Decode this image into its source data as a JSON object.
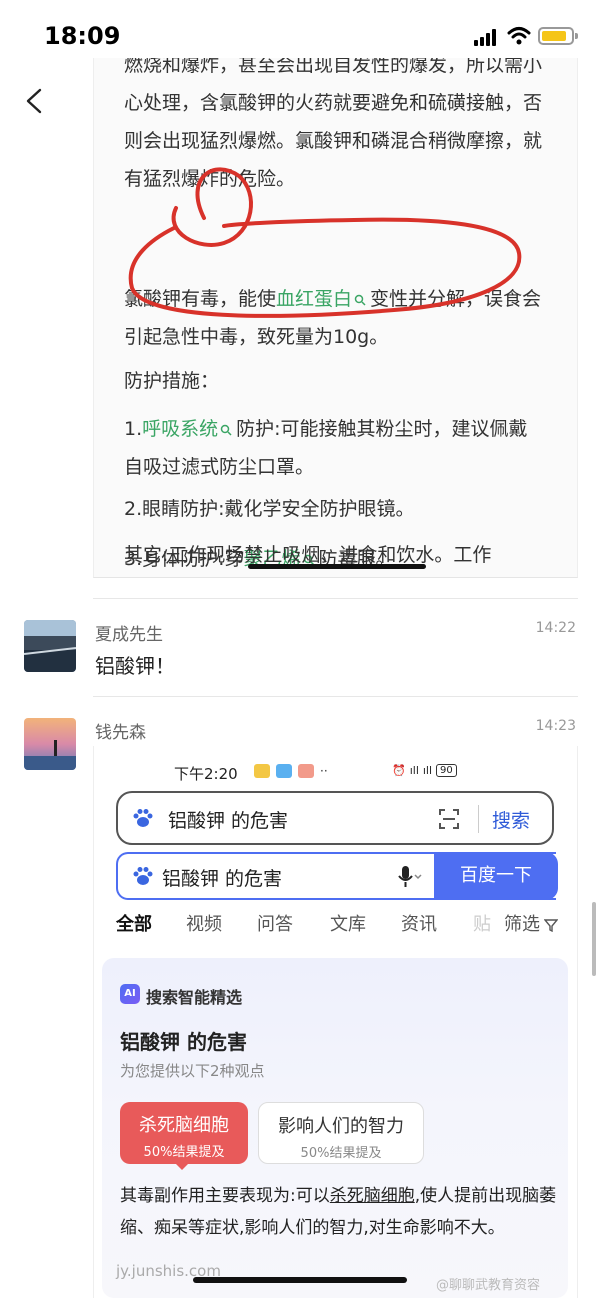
{
  "status_bar": {
    "time": "18:09"
  },
  "article": {
    "para1": "燃烧和爆炸，甚至会出现自发性的爆发，所以需小心处理，含氯酸钾的火药就要避免和硫磺接触，否则会出现猛烈爆燃。氯酸钾和磷混合稍微摩擦，就有猛烈爆炸的危险。",
    "para2_pre": "氯酸钾有毒，能使",
    "para2_link": "血红蛋白",
    "para2_post": "变性并分解，误食会引起急性中毒，致死量为10g。",
    "para3": "防护措施：",
    "para4_pre": "1.",
    "para4_link": "呼吸系统",
    "para4_post": "防护:可能接触其粉尘时，建议佩戴自吸过滤式防尘口罩。",
    "para5": "2.眼睛防护:戴化学安全防护眼镜。",
    "para6_pre": "3.身体防护:穿",
    "para6_link": "聚乙烯",
    "para6_post": "防毒服。",
    "para7": "其它:工作现场禁止吸烟、进食和饮水。工作"
  },
  "messages": [
    {
      "sender": "夏成先生",
      "time": "14:22",
      "text": "铝酸钾！"
    },
    {
      "sender": "钱先森",
      "time": "14:23"
    }
  ],
  "shot": {
    "time": "下午2:20",
    "battery": "90",
    "query": "铝酸钾 的危害",
    "search_label": "搜索",
    "baidu_label": "百度一下",
    "tabs": [
      "全部",
      "视频",
      "问答",
      "文库",
      "资讯",
      "贴",
      "筛选"
    ],
    "ai": {
      "badge": "AI",
      "title": "搜索智能精选",
      "heading": "铝酸钾 的危害",
      "sub": "为您提供以下2种观点",
      "chips": [
        {
          "label": "杀死脑细胞",
          "pct": "50%结果提及"
        },
        {
          "label": "影响人们的智力",
          "pct": "50%结果提及"
        }
      ],
      "body_pre": "其毒副作用主要表现为:可以",
      "body_u": "杀死脑细胞",
      "body_post": ",使人提前出现脑萎缩、痴呆等症状,影响人们的智力,对生命影响不大。"
    },
    "source": "jy.junshis.com"
  },
  "watermark": "@聊聊武教育资容",
  "colors": {
    "accent_blue": "#4e6ef2",
    "chip_red": "#e85a5a",
    "link_green": "#3aa564",
    "annotation_red": "#d8322a"
  }
}
